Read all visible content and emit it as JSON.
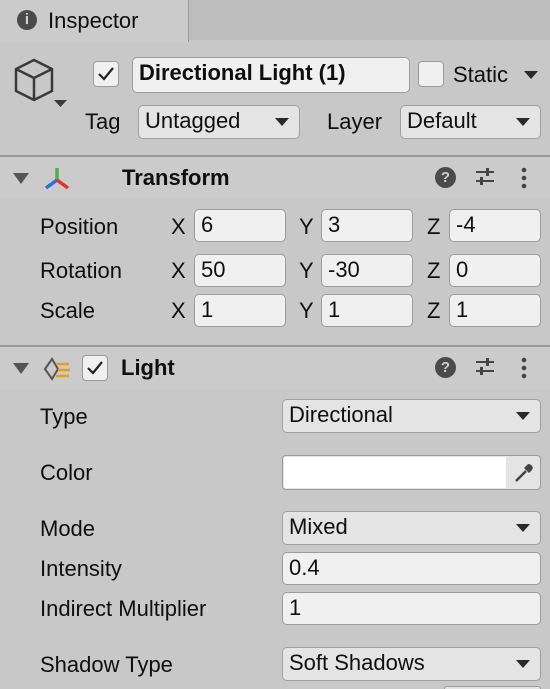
{
  "tab": {
    "title": "Inspector"
  },
  "header": {
    "object_name": "Directional Light (1)",
    "static_label": "Static",
    "tag_label": "Tag",
    "tag_value": "Untagged",
    "layer_label": "Layer",
    "layer_value": "Default"
  },
  "transform": {
    "title": "Transform",
    "rows": [
      {
        "label": "Position",
        "x": "6",
        "y": "3",
        "z": "-4"
      },
      {
        "label": "Rotation",
        "x": "50",
        "y": "-30",
        "z": "0"
      },
      {
        "label": "Scale",
        "x": "1",
        "y": "1",
        "z": "1"
      }
    ],
    "axis": {
      "x": "X",
      "y": "Y",
      "z": "Z"
    }
  },
  "light": {
    "title": "Light",
    "type_label": "Type",
    "type_value": "Directional",
    "color_label": "Color",
    "color_value": "#ffffff",
    "mode_label": "Mode",
    "mode_value": "Mixed",
    "intensity_label": "Intensity",
    "intensity_value": "0.4",
    "indirect_label": "Indirect Multiplier",
    "indirect_value": "1",
    "shadow_label": "Shadow Type",
    "shadow_value": "Soft Shadows"
  },
  "colors": {
    "panel": "#c8c8c8",
    "tab": "#cbcbcb",
    "field": "#f0f0f0"
  }
}
